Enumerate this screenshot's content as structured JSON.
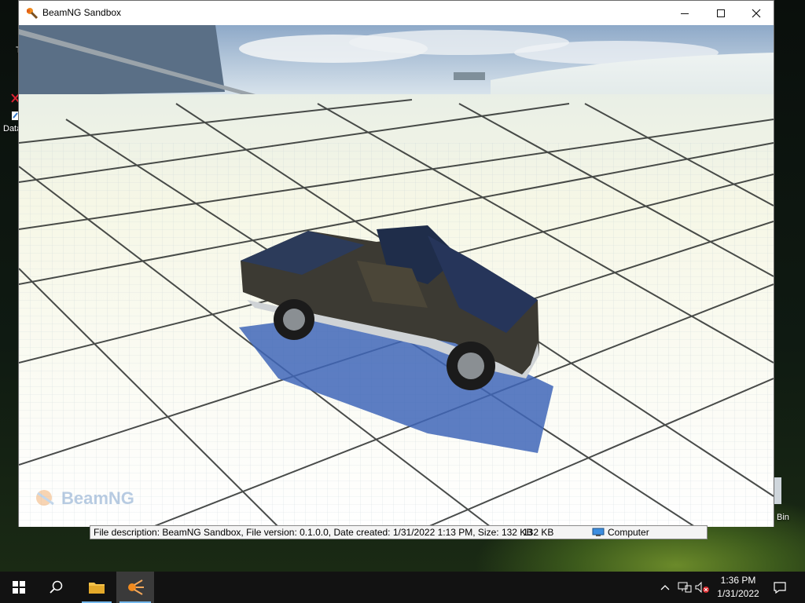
{
  "window": {
    "title": "BeamNG Sandbox",
    "buttons": {
      "minimize": "—",
      "maximize": "☐",
      "close": "✕"
    }
  },
  "viewport": {
    "watermark": "BeamNG"
  },
  "infobar": {
    "description": "File description: BeamNG Sandbox, File version: 0.1.0.0, Date created: 1/31/2022 1:13 PM, Size: 132 KB",
    "size": "132 KB",
    "location": "Computer"
  },
  "desktop": {
    "icons": [
      {
        "label": "T"
      },
      {
        "label": "Data"
      },
      {
        "label": "Bin"
      }
    ]
  },
  "taskbar": {
    "time": "1:36 PM",
    "date": "1/31/2022",
    "items": [
      "start",
      "search",
      "file-explorer",
      "beamng"
    ]
  },
  "colors": {
    "taskbar": "#121212",
    "active_indicator": "#76b9ed",
    "sky": "#9fb6cf",
    "grid_floor": "#f2f6ee"
  }
}
